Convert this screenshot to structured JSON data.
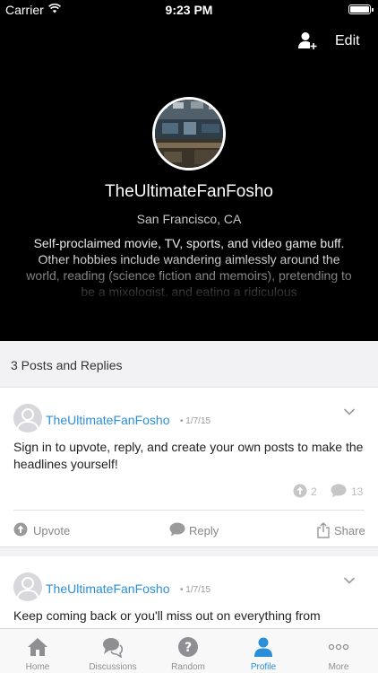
{
  "status_bar": {
    "carrier": "Carrier",
    "time": "9:23 PM",
    "battery_level": 1.0
  },
  "header": {
    "edit_label": "Edit",
    "add_user_icon": "add-user-icon"
  },
  "profile": {
    "username": "TheUltimateFanFosho",
    "location": "San Francisco, CA",
    "bio": "Self-proclaimed movie, TV, sports, and video game buff. Other hobbies include wandering aimlessly around the world, reading (science fiction and memoirs), pretending to be a mixologist, and eating a ridiculous"
  },
  "posts_header": "3 Posts and Replies",
  "posts": [
    {
      "author": "TheUltimateFanFosho",
      "date": "• 1/7/15",
      "body": "Sign in to upvote, reply, and create your own posts to make the headlines yourself!",
      "upvotes": "2",
      "replies": "13",
      "actions": {
        "upvote": "Upvote",
        "reply": "Reply",
        "share": "Share"
      }
    },
    {
      "author": "TheUltimateFanFosho",
      "date": "• 1/7/15",
      "body": "Keep coming back or you'll miss out on everything from"
    }
  ],
  "tabs": [
    {
      "label": "Home",
      "icon": "home-icon"
    },
    {
      "label": "Discussions",
      "icon": "discussions-icon"
    },
    {
      "label": "Random",
      "icon": "random-icon"
    },
    {
      "label": "Profile",
      "icon": "profile-icon",
      "active": true
    },
    {
      "label": "More",
      "icon": "more-icon"
    }
  ],
  "colors": {
    "accent": "#2a8fd8",
    "header_bg": "#000000",
    "tab_inactive": "#8e8e93"
  }
}
